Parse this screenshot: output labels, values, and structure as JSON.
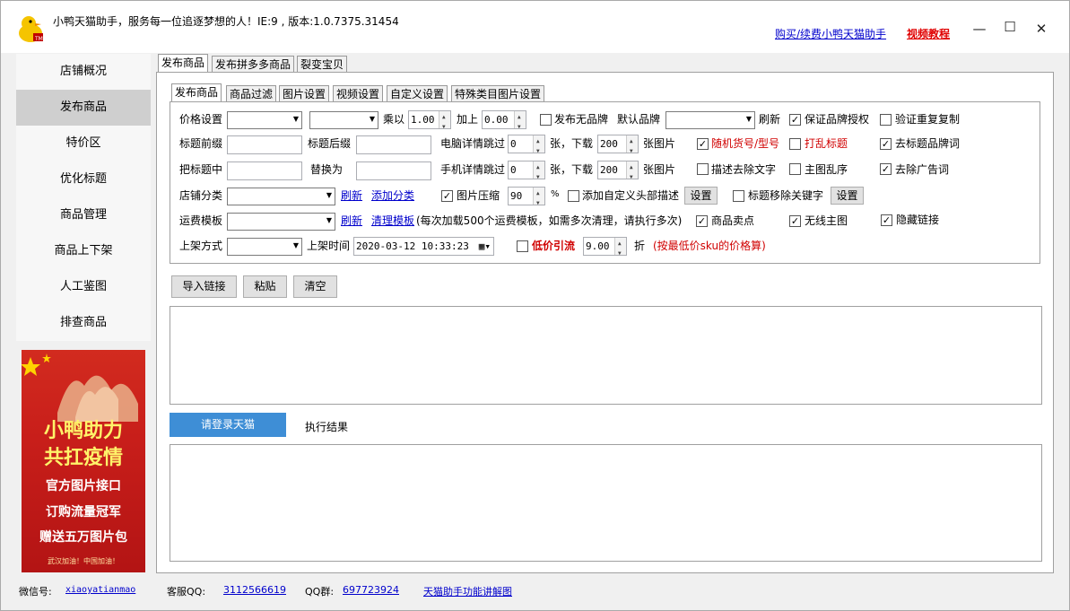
{
  "window": {
    "title": "小鸭天猫助手，服务每一位追逐梦想的人！IE:9 , 版本:1.0.7375.31454",
    "buy_link": "购买/续费小鸭天猫助手",
    "video_link": "视频教程",
    "minimize": "—",
    "maximize": "☐",
    "close": "✕"
  },
  "sidebar": {
    "items": [
      {
        "label": "店铺概况"
      },
      {
        "label": "发布商品"
      },
      {
        "label": "特价区"
      },
      {
        "label": "优化标题"
      },
      {
        "label": "商品管理"
      },
      {
        "label": "商品上下架"
      },
      {
        "label": "人工鉴图"
      },
      {
        "label": "排查商品"
      }
    ]
  },
  "ad": {
    "line1": "小鸭助力",
    "line2": "共扛疫情",
    "line3": "官方图片接口",
    "line4": "订购流量冠军",
    "line5": "赠送五万图片包",
    "line6": "武汉加油！中国加油！"
  },
  "top_tabs": [
    "发布商品",
    "发布拼多多商品",
    "裂变宝贝"
  ],
  "sub_tabs": [
    "发布商品",
    "商品过滤",
    "图片设置",
    "视频设置",
    "自定义设置",
    "特殊类目图片设置"
  ],
  "form": {
    "price_label": "价格设置",
    "multiply_label": "乘以",
    "multiply_value": "1.00",
    "add_label": "加上",
    "add_value": "0.00",
    "no_brand_label": "发布无品牌",
    "default_brand_label": "默认品牌",
    "refresh1": "刷新",
    "guarantee_brand_label": "保证品牌授权",
    "verify_dup_label": "验证重复复制",
    "title_prefix_label": "标题前缀",
    "title_suffix_label": "标题后缀",
    "pc_detail_skip_label": "电脑详情跳过",
    "pc_skip_value": "0",
    "pc_zhang_label": "张，下载",
    "pc_download_value": "200",
    "pc_pics_label": "张图片",
    "random_sku_label": "随机货号/型号",
    "shuffle_title_label": "打乱标题",
    "remove_brand_label": "去标题品牌词",
    "title_replace_label": "把标题中",
    "replace_with_label": "替换为",
    "mobile_detail_skip_label": "手机详情跳过",
    "mobile_skip_value": "0",
    "mobile_zhang_label": "张，下载",
    "mobile_download_value": "200",
    "mobile_pics_label": "张图片",
    "desc_remove_text_label": "描述去除文字",
    "main_img_shuffle_label": "主图乱序",
    "remove_ad_words_label": "去除广告词",
    "shop_category_label": "店铺分类",
    "refresh2": "刷新",
    "add_category": "添加分类",
    "img_compress_label": "图片压缩",
    "img_compress_value": "90",
    "percent": "%",
    "custom_header_label": "添加自定义头部描述",
    "settings1": "设置",
    "title_remove_kw_label": "标题移除关键字",
    "settings2": "设置",
    "freight_label": "运费模板",
    "refresh3": "刷新",
    "clear_template": "清理模板",
    "freight_note": "(每次加载500个运费模板，如需多次清理，请执行多次)",
    "selling_point_label": "商品卖点",
    "no_wire_main_label": "无线主图",
    "hide_link_label": "隐藏链接",
    "listing_method_label": "上架方式",
    "listing_time_label": "上架时间",
    "listing_time_value": "2020-03-12  10:33:23",
    "low_price_label": "低价引流",
    "discount_value": "9.00",
    "discount_unit": "折",
    "low_price_note": "(按最低价sku的价格算)"
  },
  "buttons": {
    "import": "导入链接",
    "paste": "粘贴",
    "clear": "清空",
    "login": "请登录天猫",
    "result": "执行结果"
  },
  "footer": {
    "wechat_label": "微信号:",
    "wechat_value": "xiaoyatianmao",
    "qq_label": "客服QQ:",
    "qq_value": "3112566619",
    "qqgroup_label": "QQ群:",
    "qqgroup_value": "697723924",
    "guide_link": "天猫助手功能讲解图"
  },
  "colors": {
    "accent_blue": "#3e8ed6",
    "link_blue": "#0000cc",
    "warning_red": "#d00000",
    "sidebar_active": "#cfcfcf"
  }
}
